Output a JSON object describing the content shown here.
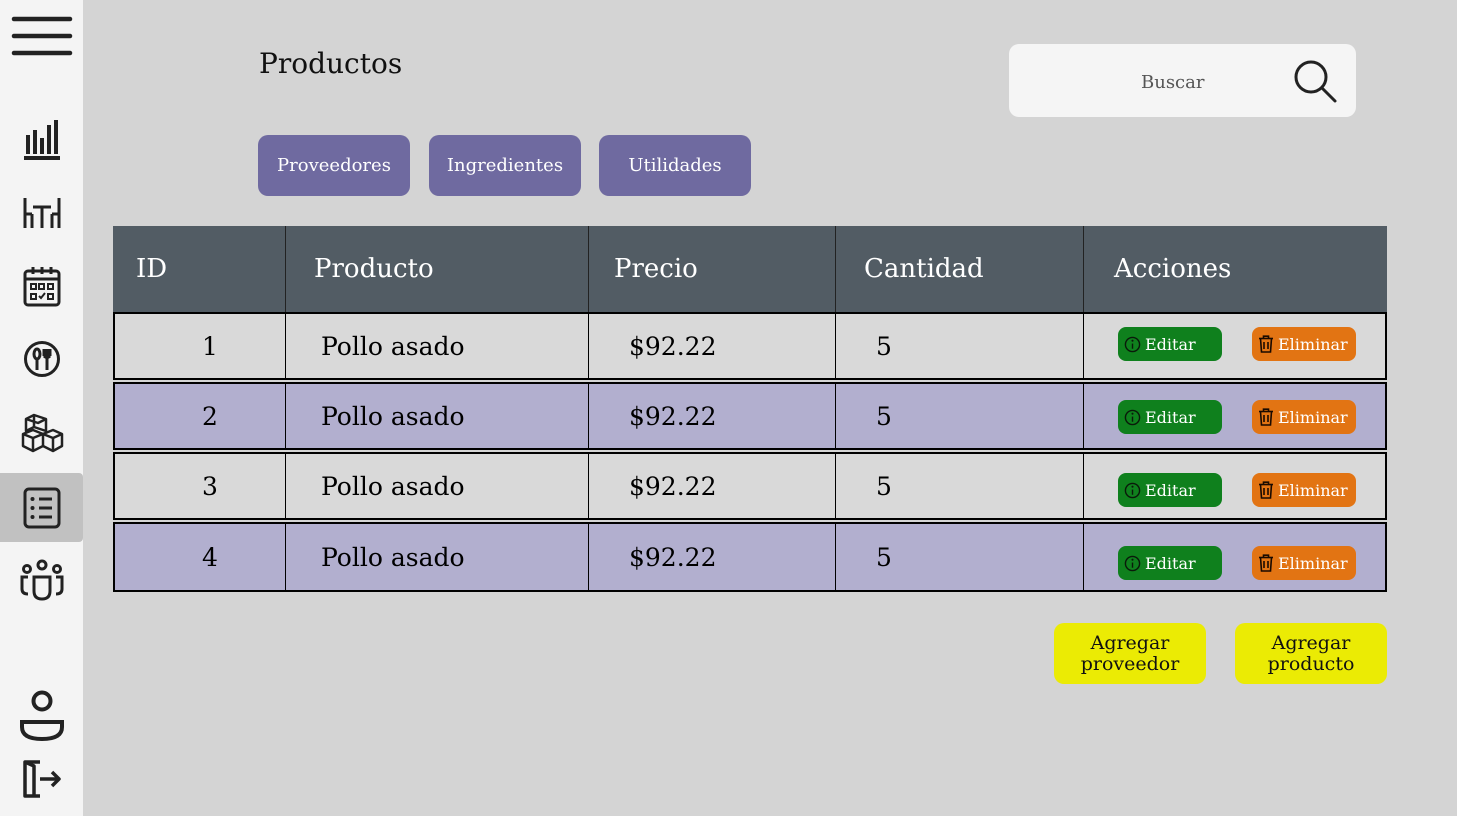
{
  "page": {
    "title": "Productos"
  },
  "search": {
    "placeholder": "Buscar"
  },
  "tabs": [
    {
      "label": "Proveedores"
    },
    {
      "label": "Ingredientes"
    },
    {
      "label": "Utilidades"
    }
  ],
  "table": {
    "columns": [
      "ID",
      "Producto",
      "Precio",
      "Cantidad",
      "Acciones"
    ],
    "rows": [
      {
        "id": "1",
        "producto": "Pollo asado",
        "precio": "$92.22",
        "cantidad": "5"
      },
      {
        "id": "2",
        "producto": "Pollo asado",
        "precio": "$92.22",
        "cantidad": "5"
      },
      {
        "id": "3",
        "producto": "Pollo asado",
        "precio": "$92.22",
        "cantidad": "5"
      },
      {
        "id": "4",
        "producto": "Pollo asado",
        "precio": "$92.22",
        "cantidad": "5"
      }
    ],
    "actions": {
      "edit_label": "Editar",
      "delete_label": "Eliminar"
    }
  },
  "buttons": {
    "add_supplier": "Agregar proveedor",
    "add_product": "Agregar producto"
  },
  "sidebar": {
    "items": [
      {
        "icon": "menu-icon"
      },
      {
        "icon": "bar-chart-icon"
      },
      {
        "icon": "tables-icon"
      },
      {
        "icon": "calendar-icon"
      },
      {
        "icon": "dishes-icon"
      },
      {
        "icon": "inventory-boxes-icon"
      },
      {
        "icon": "product-list-icon",
        "active": true
      },
      {
        "icon": "users-group-icon"
      },
      {
        "icon": "profile-icon"
      },
      {
        "icon": "logout-icon"
      }
    ]
  },
  "colors": {
    "background": "#d4d4d4",
    "sidebar": "#f4f4f4",
    "tab": "#6f6aa0",
    "table_header": "#525c64",
    "row_alt": "#b2afcf",
    "row": "#d9d9d9",
    "edit": "#0f801d",
    "delete": "#e27413",
    "add_button": "#ebeb04"
  }
}
